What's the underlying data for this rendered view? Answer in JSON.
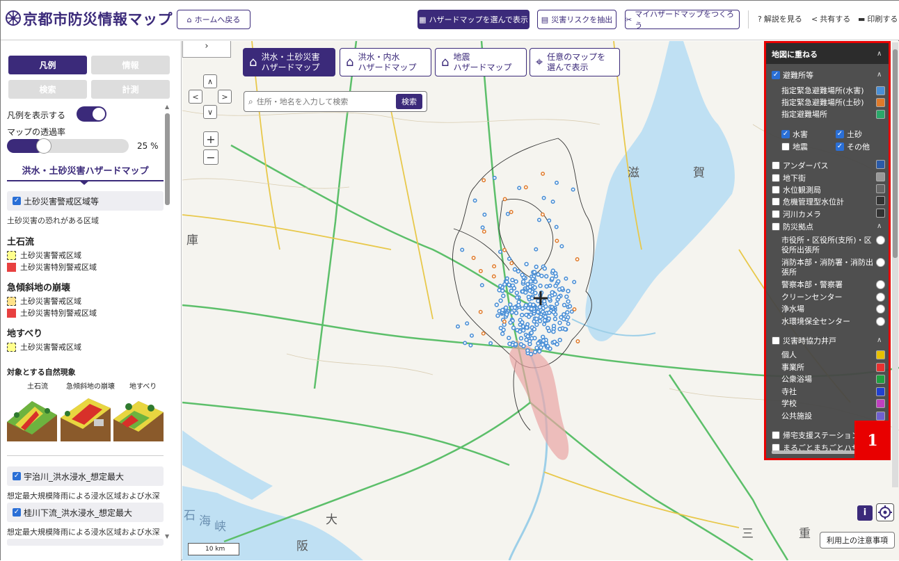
{
  "header": {
    "title": "京都市防災情報マップ",
    "home_label": "ホームへ戻る",
    "select_hazard_label": "ハザードマップを選んで表示",
    "extract_risk_label": "災害リスクを抽出",
    "my_hazard_label": "マイハザードマップをつくろう",
    "help_label": "解説を見る",
    "share_label": "共有する",
    "print_label": "印刷する"
  },
  "left": {
    "tabs": [
      "凡例",
      "情報",
      "検索",
      "計測"
    ],
    "show_legend_label": "凡例を表示する",
    "opacity_label": "マップの透過率",
    "opacity_value": "25 %",
    "opacity_fraction": 0.25,
    "section_title": "洪水・土砂災害ハザードマップ",
    "layer1": "土砂災害警戒区域等",
    "layer1_desc": "土砂災害の恐れがある区域",
    "debris_flow": "土石流",
    "steep_slope": "急傾斜地の崩壊",
    "landslide": "地すべり",
    "warning_area": "土砂災害警戒区域",
    "special_area": "土砂災害特別警戒区域",
    "phenomena_title": "対象とする自然現象",
    "phenomena": [
      "土石流",
      "急傾斜地の崩壊",
      "地すべり"
    ],
    "layer2": "宇治川_洪水浸水_想定最大",
    "layer2_desc": "想定最大規模降雨による浸水区域および水深",
    "layer3": "桂川下流_洪水浸水_想定最大",
    "layer3_desc": "想定最大規模降雨による浸水区域および水深"
  },
  "map": {
    "tabs": [
      {
        "line1": "洪水・土砂災害",
        "line2": "ハザードマップ"
      },
      {
        "line1": "洪水・内水",
        "line2": "ハザードマップ"
      },
      {
        "line1": "地震",
        "line2": "ハザードマップ"
      },
      {
        "line1": "任意のマップを",
        "line2": "選んで表示"
      }
    ],
    "search_placeholder": "住所・地名を入力して検索",
    "search_button": "検索",
    "scale_label": "10 km",
    "notice_label": "利用上の注意事項",
    "place_labels": [
      "滋",
      "賀",
      "庫",
      "大",
      "阪",
      "三",
      "重",
      "石",
      "海",
      "峡"
    ]
  },
  "overlay": {
    "title": "地図に重ねる",
    "shelters": "避難所等",
    "shelter_items": [
      "指定緊急避難場所(水害)",
      "指定緊急避難場所(土砂)",
      "指定避難場所"
    ],
    "filters": [
      "水害",
      "土砂",
      "地震",
      "その他"
    ],
    "items": [
      "アンダーパス",
      "地下街",
      "水位観測局",
      "危機管理型水位計",
      "河川カメラ",
      "防災拠点"
    ],
    "base_items": [
      "市役所・区役所(支所)・区役所出張所",
      "消防本部・消防署・消防出張所",
      "警察本部・警察署",
      "クリーンセンター",
      "浄水場",
      "水環境保全センター"
    ],
    "wells": "災害時協力井戸",
    "well_items": [
      "個人",
      "事業所",
      "公衆浴場",
      "寺社",
      "学校",
      "公共施設"
    ],
    "more_items": [
      "帰宅支援ステーション",
      "まるごとまちごとハザードマップ"
    ]
  },
  "annotation_badge": "1"
}
